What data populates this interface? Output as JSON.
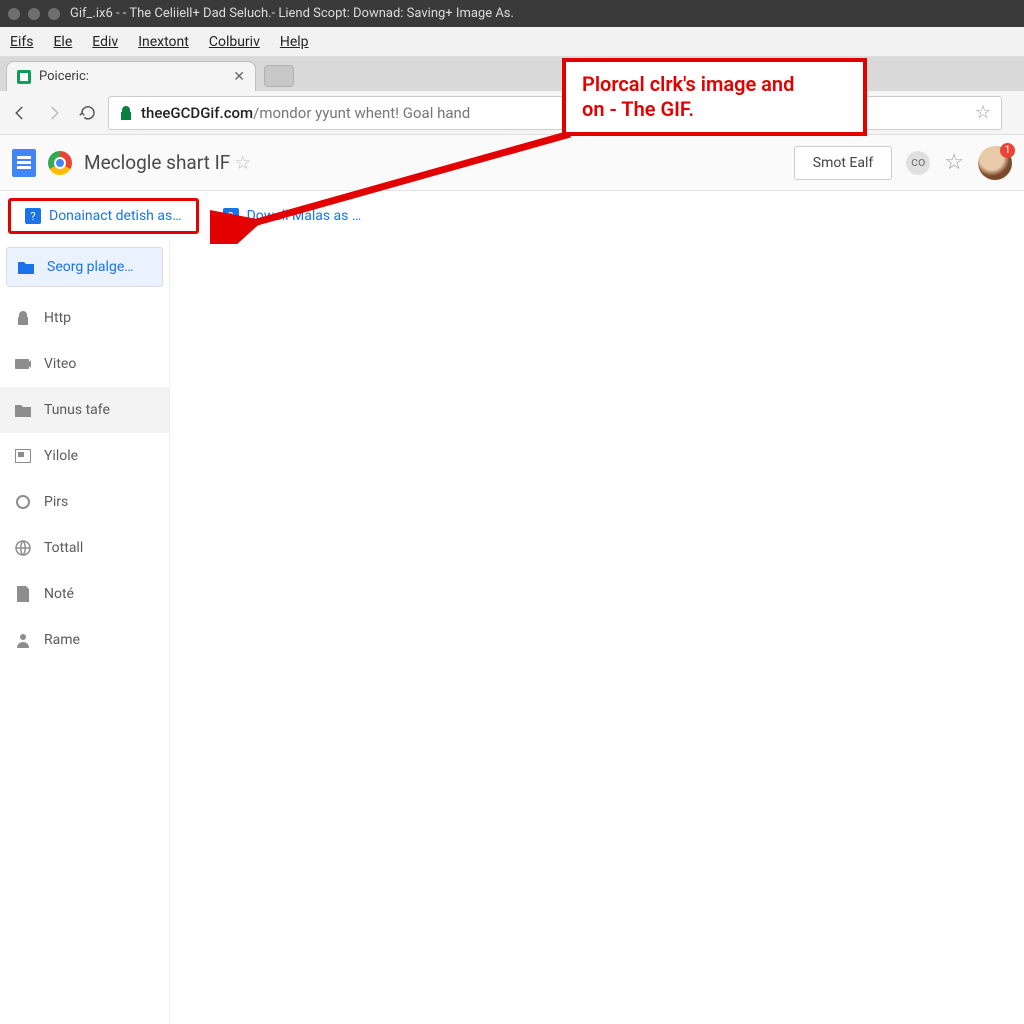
{
  "os": {
    "title": "Gif_.ix6 - - The Celiiell+ Dad Seluch.- Liend Scopt: Downad: Saving+ Image As."
  },
  "menubar": {
    "items": [
      "Eifs",
      "Ele",
      "Ediv",
      "Inextont",
      "Colburiv",
      "Help"
    ]
  },
  "tab": {
    "label": "Poiceric:"
  },
  "address": {
    "domain": "theeGCDGif.com",
    "path": "/mondor yyunt whent! Goal hand"
  },
  "doc": {
    "title": "Meclogle shart IF",
    "share": "Smot Ealf",
    "grey_circle": "co",
    "avatar_badge": "1"
  },
  "toolbar": {
    "chip1": "Donainact detish as…",
    "chip2": "Dowell Malas as …"
  },
  "callout": {
    "line1": "Plorcal clrk's image and",
    "line2": "on - The GIF."
  },
  "sidebar": {
    "selected": "Seorg plalge…",
    "items": [
      {
        "icon": "lock",
        "label": "Http"
      },
      {
        "icon": "clip",
        "label": "Viteo"
      },
      {
        "icon": "folder",
        "label": "Tunus tafe"
      },
      {
        "icon": "aspect",
        "label": "Yilole"
      },
      {
        "icon": "circle",
        "label": "Pirs"
      },
      {
        "icon": "globe",
        "label": "Tottall"
      },
      {
        "icon": "note",
        "label": "Noté"
      },
      {
        "icon": "person",
        "label": "Rame"
      }
    ]
  }
}
